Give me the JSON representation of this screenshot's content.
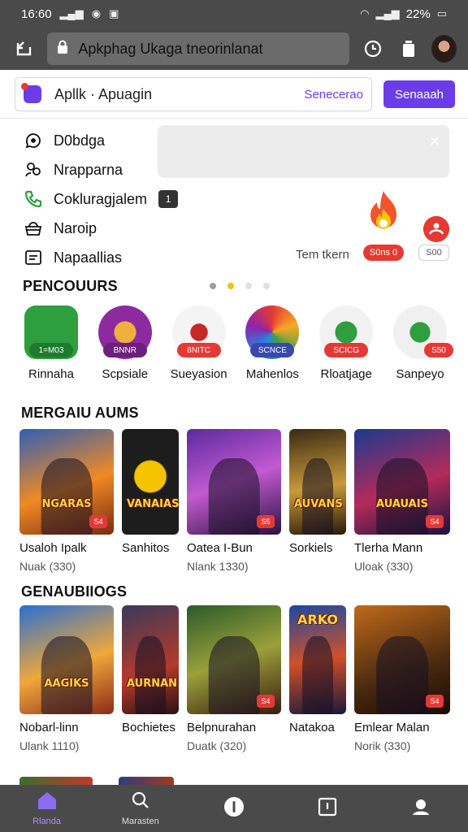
{
  "status_bar": {
    "time": "16:60",
    "battery": "22%"
  },
  "browser": {
    "url": "Apkphag Ukaga tneorinlanat"
  },
  "app_header": {
    "name": "Apllk · Apuagin",
    "link": "Senecerao",
    "action": "Senaaah"
  },
  "menu": [
    {
      "label": "D0bdga",
      "icon": "chat-icon"
    },
    {
      "label": "Nrapparna",
      "icon": "users-icon"
    },
    {
      "label": "Cokluragjalem",
      "icon": "phone-icon",
      "badge": "1"
    },
    {
      "label": "Naroip",
      "icon": "basket-icon"
    },
    {
      "label": "Napaallias",
      "icon": "list-icon"
    }
  ],
  "promo": {
    "caption": "Tem tkern",
    "fire_badge": "S0ns 0",
    "alert_badge": "S00"
  },
  "sections": {
    "popular": "PENCOUURS",
    "games": "MERGAIU AUMS",
    "genres": "GENAUBIIOGS"
  },
  "apps": [
    {
      "name": "Rinnaha",
      "label": "1=M03",
      "color": "#2e9e3e"
    },
    {
      "name": "Scpsiale",
      "label": "BNNR",
      "color": "#8e2aa0"
    },
    {
      "name": "Sueyasion",
      "label": "8NITC",
      "color": "#f4f4f4"
    },
    {
      "name": "Mahenlos",
      "label": "SCNCE",
      "color": "#e8e8ff"
    },
    {
      "name": "Rloatjage",
      "label": "SCICG",
      "color": "#f2f2f2"
    },
    {
      "name": "Sanpeyo",
      "label": "S50",
      "color": "#f0f0f0"
    }
  ],
  "games": [
    {
      "name": "Usaloh Ipalk",
      "meta": "Nuak (330)",
      "cover": "NGARAS",
      "badge": "S4"
    },
    {
      "name": "Sanhitos",
      "meta": "",
      "cover": "VANAIAS",
      "badge": ""
    },
    {
      "name": "Oatea I-Bun",
      "meta": "Nlank 1330)",
      "cover": "",
      "badge": "S5"
    },
    {
      "name": "Sorkiels",
      "meta": "",
      "cover": "AUVANS",
      "badge": ""
    },
    {
      "name": "Tlerha Mann",
      "meta": "Uloak (330)",
      "cover": "AUAUAIS",
      "badge": "S4"
    }
  ],
  "genres": [
    {
      "name": "Nobarl-linn",
      "meta": "Ulank 1110)",
      "cover": "AAGIKS",
      "badge": ""
    },
    {
      "name": "Bochietes",
      "meta": "",
      "cover": "AURNAN",
      "badge": ""
    },
    {
      "name": "Belpnurahan",
      "meta": "Duatk (320)",
      "cover": "",
      "badge": "S4"
    },
    {
      "name": "Natakoa",
      "meta": "",
      "cover": "ARKO",
      "badge": ""
    },
    {
      "name": "Emlear Malan",
      "meta": "Norik (330)",
      "cover": "",
      "badge": "S4"
    }
  ],
  "nav": [
    {
      "label": "Rlanda",
      "icon": "home-icon"
    },
    {
      "label": "Marasten",
      "icon": "search-icon"
    },
    {
      "label": "",
      "icon": "info-icon"
    },
    {
      "label": "",
      "icon": "inbox-icon"
    },
    {
      "label": "",
      "icon": "profile-icon"
    }
  ]
}
